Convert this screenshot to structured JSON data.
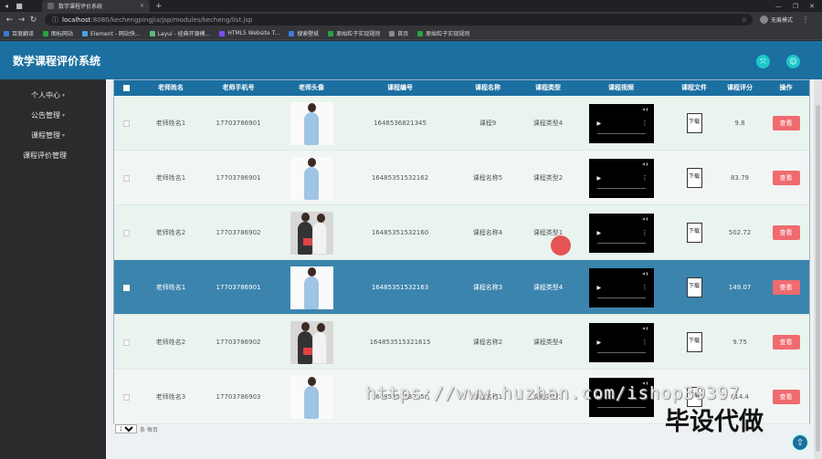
{
  "browser": {
    "tab_title": "数学课程评价系统",
    "url_host": "localhost",
    "url_rest": ":8080/kechengpingjia/jsp/modules/kecheng/list.jsp",
    "profile_label": "无痕模式",
    "bookmarks": [
      {
        "label": "百度翻译",
        "color": "#3b7bd8"
      },
      {
        "label": "图标网站",
        "color": "#27a243"
      },
      {
        "label": "Element - 网站快...",
        "color": "#4aa4e8"
      },
      {
        "label": "Layui - 经典开源模...",
        "color": "#5fb878"
      },
      {
        "label": "HTML5 Website T...",
        "color": "#7c4dff"
      },
      {
        "label": "搜索壁纸",
        "color": "#3b7bd8"
      },
      {
        "label": "原始粒子实现规则",
        "color": "#27a243"
      },
      {
        "label": "首页",
        "color": "#888888"
      },
      {
        "label": "原始粒子实现规则",
        "color": "#27a243"
      }
    ]
  },
  "app": {
    "title": "数学课程评价系统"
  },
  "sidebar": {
    "items": [
      {
        "label": "个人中心",
        "has_arrow": true
      },
      {
        "label": "公告管理",
        "has_arrow": true
      },
      {
        "label": "课程管理",
        "has_arrow": true
      },
      {
        "label": "课程评价管理",
        "has_arrow": false
      }
    ]
  },
  "table": {
    "headers": [
      "老师姓名",
      "老师手机号",
      "老师头像",
      "课程编号",
      "课程名称",
      "课程类型",
      "课程视频",
      "课程文件",
      "课程评分",
      "操作"
    ],
    "download_label": "下载",
    "view_label": "查看",
    "rows": [
      {
        "teacher": "老师姓名1",
        "phone": "17703786901",
        "code": "1648536821345",
        "course": "课程9",
        "type": "课程类型4",
        "score": "9.8",
        "avatar": "man"
      },
      {
        "teacher": "老师姓名1",
        "phone": "17703786901",
        "code": "16485351532162",
        "course": "课程名称5",
        "type": "课程类型2",
        "score": "83.79",
        "avatar": "man"
      },
      {
        "teacher": "老师姓名2",
        "phone": "17703786902",
        "code": "16485351532160",
        "course": "课程名称4",
        "type": "课程类型1",
        "score": "502.72",
        "avatar": "woman"
      },
      {
        "teacher": "老师姓名1",
        "phone": "17703786901",
        "code": "16485351532163",
        "course": "课程名称3",
        "type": "课程类型4",
        "score": "149.07",
        "avatar": "man"
      },
      {
        "teacher": "老师姓名2",
        "phone": "17703786902",
        "code": "164853515321615",
        "course": "课程名称2",
        "type": "课程类型4",
        "score": "9.75",
        "avatar": "woman"
      },
      {
        "teacher": "老师姓名3",
        "phone": "17703786903",
        "code": "16485351532158",
        "course": "课程名称1",
        "type": "课程类型2",
        "score": "814.4",
        "avatar": "man"
      }
    ],
    "selected_row": 3
  },
  "pager": {
    "page_size": "10",
    "suffix": "条 每页"
  },
  "overlay": {
    "watermark": "https://www.huzhan.com/ishop39397",
    "caption": "毕设代做"
  }
}
